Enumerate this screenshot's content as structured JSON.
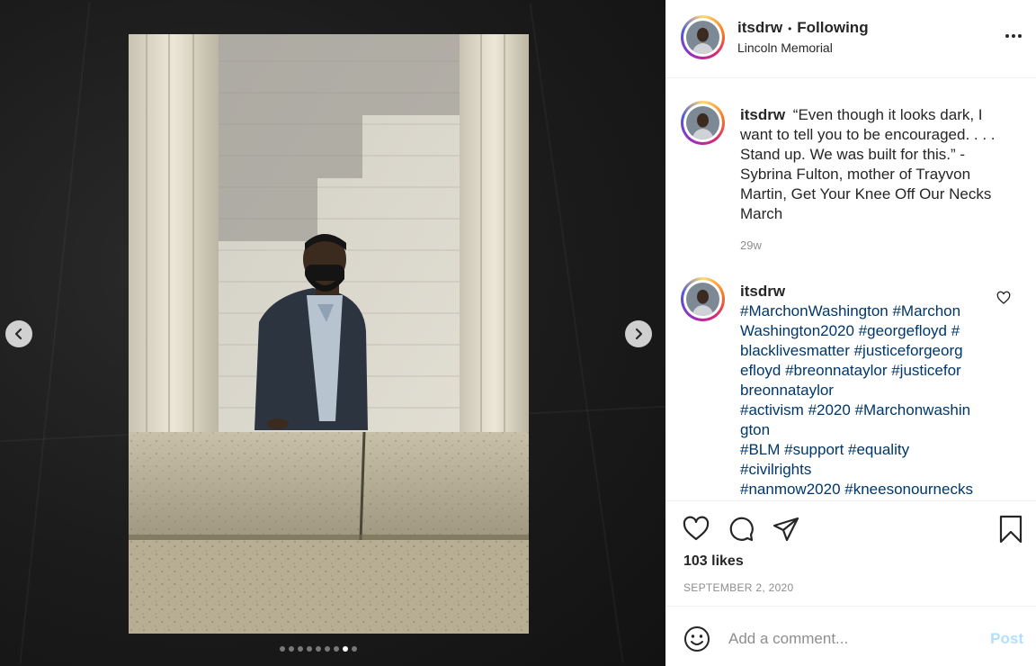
{
  "post": {
    "username": "itsdrw",
    "separator": "•",
    "follow_status": "Following",
    "location": "Lincoln Memorial"
  },
  "carousel": {
    "slide_count": 9,
    "active_index": 7
  },
  "caption": {
    "username": "itsdrw",
    "text": "“Even though it looks dark, I want to tell you to be encouraged. . . . Stand up. We was built for this.” -Sybrina Fulton, mother of Trayvon Martin, Get Your Knee Off Our Necks March",
    "time": "29w"
  },
  "comment": {
    "username": "itsdrw",
    "hashtag_lines": [
      "#MarchonWashington #Marchon",
      "Washington2020 #georgefloyd #",
      "blacklivesmatter  #justiceforgeorg",
      "efloyd #breonnataylor #justicefor",
      "breonnataylor",
      "#activism #2020 #Marchonwashin",
      "gton",
      "#BLM #support #equality",
      "#civilrights",
      "#nanmow2020 #kneesonournecks"
    ]
  },
  "engagement": {
    "likes": "103 likes",
    "date": "SEPTEMBER 2, 2020"
  },
  "add_comment": {
    "placeholder": "Add a comment...",
    "post_label": "Post"
  },
  "colors": {
    "link": "#00376b",
    "muted": "#8e8e8e",
    "post_disabled": "#b2dffc"
  },
  "icons": [
    "more-options-icon",
    "heart-icon",
    "comment-icon",
    "share-icon",
    "bookmark-icon",
    "emoji-icon",
    "chevron-left-icon",
    "chevron-right-icon"
  ]
}
